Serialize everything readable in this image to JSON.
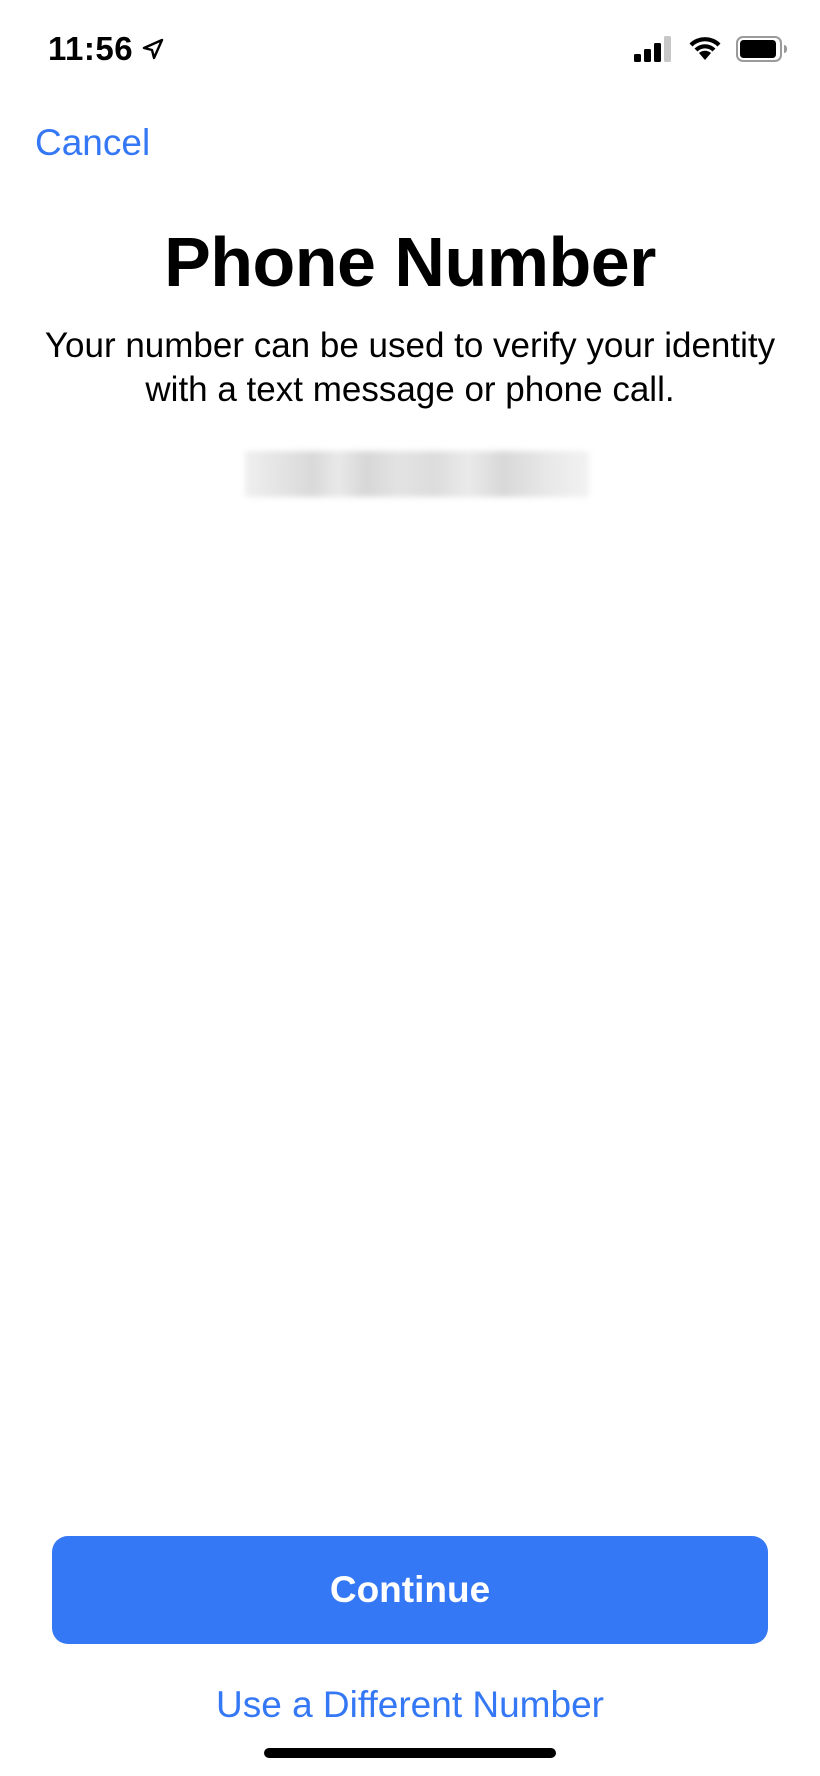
{
  "status_bar": {
    "time": "11:56",
    "location_icon": "location-arrow-icon",
    "signal_icon": "cellular-signal-icon",
    "wifi_icon": "wifi-icon",
    "battery_icon": "battery-icon"
  },
  "nav": {
    "cancel_label": "Cancel"
  },
  "content": {
    "title": "Phone Number",
    "subtitle": "Your number can be used to verify your identity with a text message or phone call."
  },
  "actions": {
    "continue_label": "Continue",
    "different_number_label": "Use a Different Number"
  },
  "colors": {
    "accent": "#3478f6",
    "background": "#ffffff",
    "text": "#000000"
  }
}
